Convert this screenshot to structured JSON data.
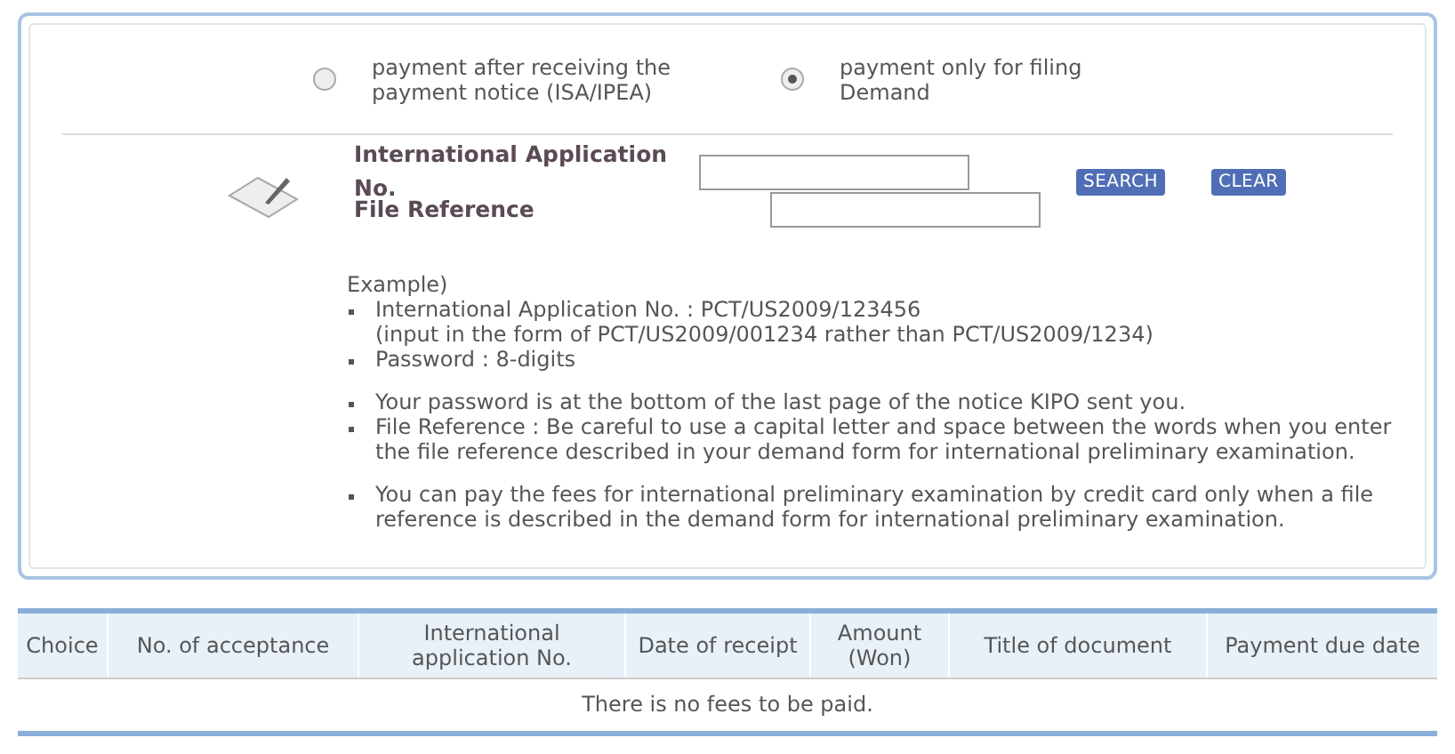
{
  "payment_options": [
    {
      "label": "payment after receiving the payment notice (ISA/IPEA)",
      "selected": false
    },
    {
      "label": "payment only for filing Demand",
      "selected": true
    }
  ],
  "search_form": {
    "fields": [
      {
        "label": "International Application No."
      },
      {
        "label": "File Reference"
      }
    ],
    "buttons": [
      "SEARCH",
      "CLEAR"
    ]
  },
  "help": {
    "title": "Example)",
    "groups": [
      [
        "International Application No. : PCT/US2009/123456\n(input in the form of PCT/US2009/001234 rather than PCT/US2009/1234)",
        "Password : 8-digits"
      ],
      [
        "Your password is at the bottom of the last page of the notice KIPO sent you.",
        "File Reference : Be careful to use a capital letter and space between the words when you enter the file reference described in your demand form for international preliminary examination."
      ],
      [
        "You can pay the fees for international preliminary examination by credit card only when a file reference is described in the demand form for international preliminary examination."
      ]
    ]
  },
  "table": {
    "columns": [
      "Choice",
      "No. of acceptance",
      "International application No.",
      "Date of receipt",
      "Amount (Won)",
      "Title of document",
      "Payment due date"
    ],
    "empty_message": "There is no fees to be paid."
  }
}
